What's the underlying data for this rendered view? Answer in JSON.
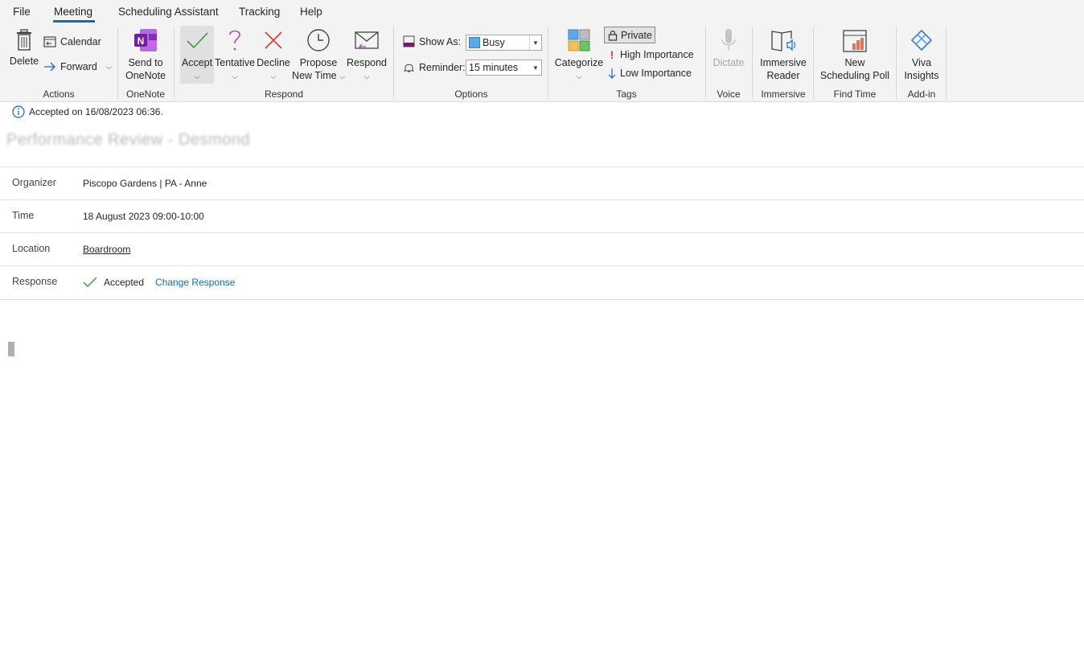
{
  "menu": {
    "file": "File",
    "meeting": "Meeting",
    "scheduling_assistant": "Scheduling Assistant",
    "tracking": "Tracking",
    "help": "Help"
  },
  "ribbon": {
    "actions": {
      "delete": "Delete",
      "calendar": "Calendar",
      "forward": "Forward",
      "group": "Actions"
    },
    "onenote": {
      "send_line1": "Send to",
      "send_line2": "OneNote",
      "group": "OneNote"
    },
    "respond": {
      "accept": "Accept",
      "tentative": "Tentative",
      "decline": "Decline",
      "propose_line1": "Propose",
      "propose_line2": "New Time",
      "respond": "Respond",
      "group": "Respond"
    },
    "options": {
      "show_as_label": "Show As:",
      "show_as_value": "Busy",
      "reminder_label": "Reminder:",
      "reminder_value": "15 minutes",
      "group": "Options"
    },
    "tags": {
      "categorize": "Categorize",
      "private": "Private",
      "high_importance": "High Importance",
      "low_importance": "Low Importance",
      "group": "Tags"
    },
    "voice": {
      "dictate": "Dictate",
      "group": "Voice"
    },
    "immersive": {
      "line1": "Immersive",
      "line2": "Reader",
      "group": "Immersive"
    },
    "find_time": {
      "line1": "New",
      "line2": "Scheduling Poll",
      "group": "Find Time"
    },
    "addin": {
      "line1": "Viva",
      "line2": "Insights",
      "group": "Add-in"
    }
  },
  "colors": {
    "accent": "#0f6cbd",
    "busy": "#5fa8e8",
    "accept_check": "#3a9c3a",
    "decline": "#e03a3a",
    "tentative": "#b146c2"
  },
  "meeting": {
    "info": "Accepted on 16/08/2023 06:36.",
    "title_obscured": "Performance Review - Desmond",
    "organizer_label": "Organizer",
    "organizer": "Piscopo Gardens | PA - Anne",
    "time_label": "Time",
    "time": "18 August 2023 09:00-10:00",
    "location_label": "Location",
    "location": "Boardroom",
    "response_label": "Response",
    "response": "Accepted",
    "change_response": "Change Response"
  }
}
